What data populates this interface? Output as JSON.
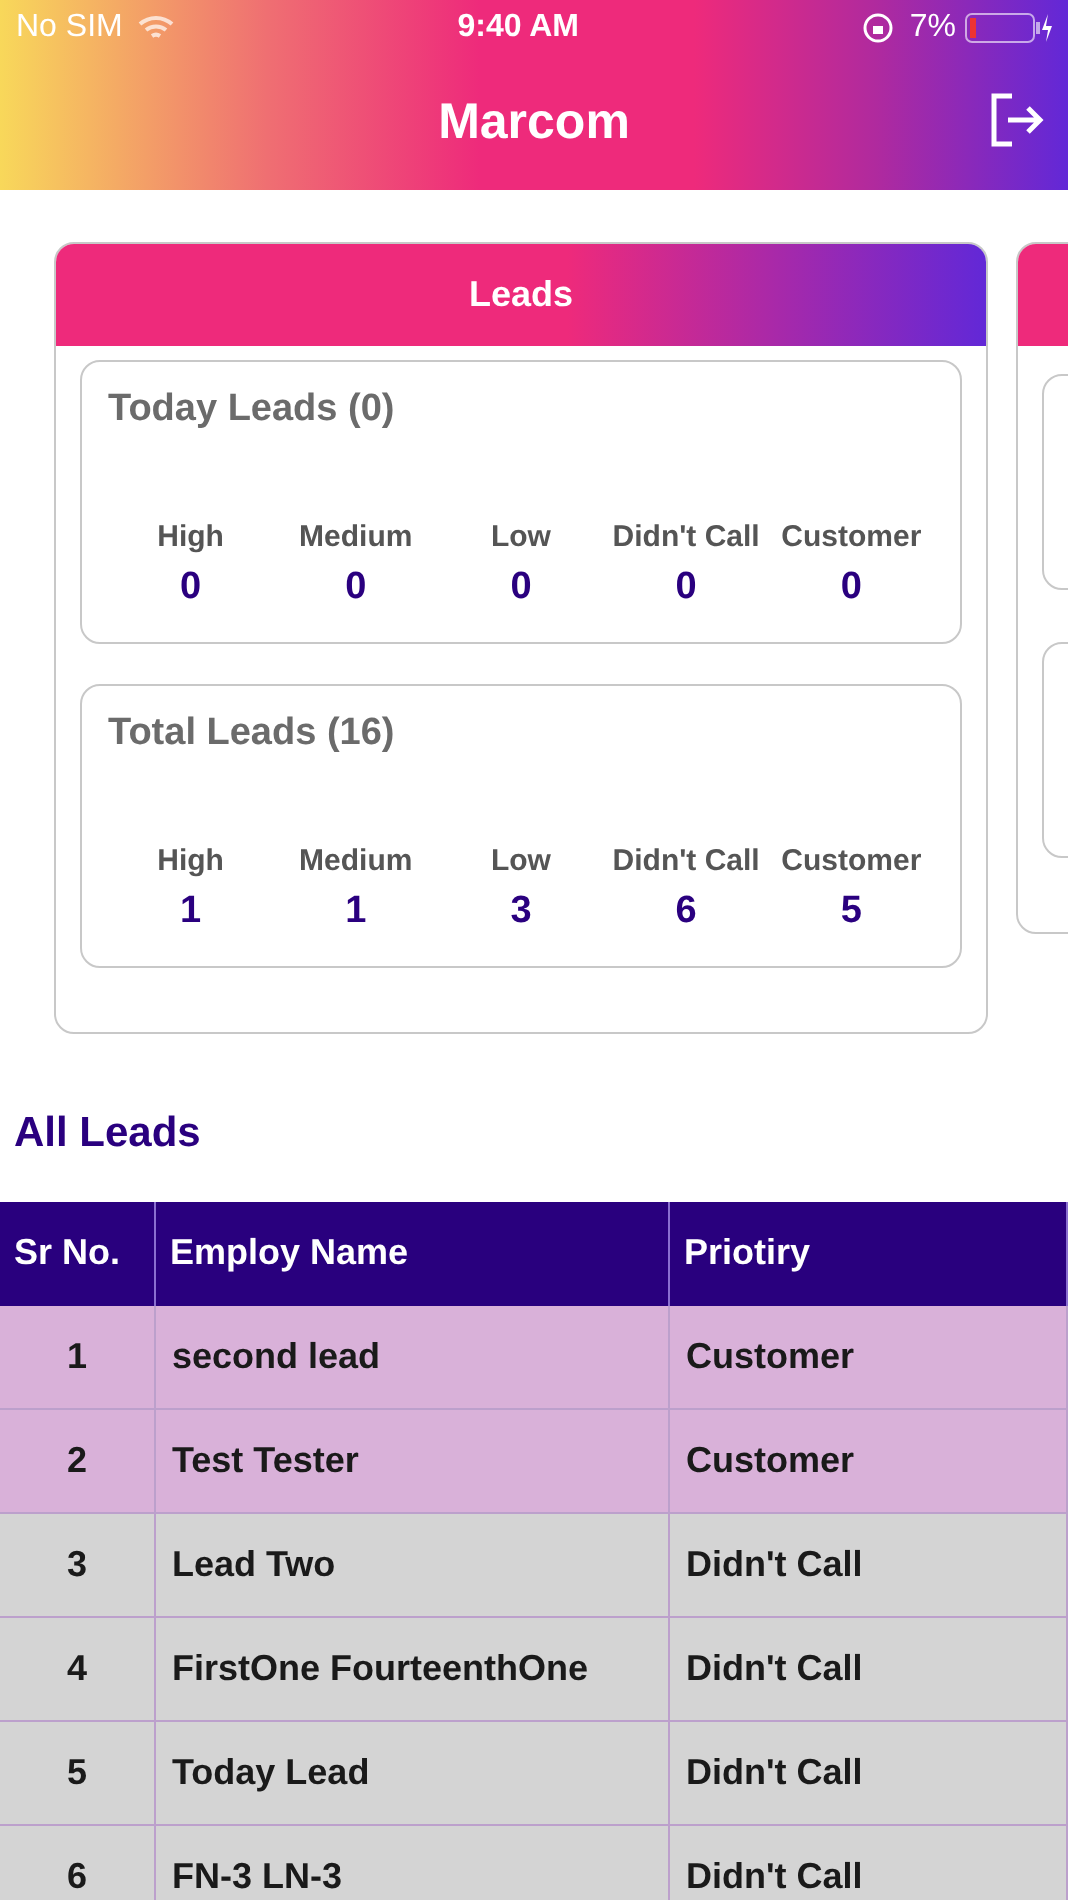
{
  "status_bar": {
    "carrier": "No SIM",
    "time": "9:40 AM",
    "battery": "7%"
  },
  "header": {
    "title": "Marcom"
  },
  "card": {
    "title": "Leads",
    "sections": [
      {
        "title": "Today Leads (0)",
        "stats": [
          {
            "label": "High",
            "value": "0"
          },
          {
            "label": "Medium",
            "value": "0"
          },
          {
            "label": "Low",
            "value": "0"
          },
          {
            "label": "Didn't Call",
            "value": "0"
          },
          {
            "label": "Customer",
            "value": "0"
          }
        ]
      },
      {
        "title": "Total Leads (16)",
        "stats": [
          {
            "label": "High",
            "value": "1"
          },
          {
            "label": "Medium",
            "value": "1"
          },
          {
            "label": "Low",
            "value": "3"
          },
          {
            "label": "Didn't Call",
            "value": "6"
          },
          {
            "label": "Customer",
            "value": "5"
          }
        ]
      }
    ]
  },
  "all_leads": {
    "title": "All Leads",
    "table": {
      "columns": [
        "Sr No.",
        "Employ Name",
        "Priotiry"
      ],
      "rows": [
        {
          "cells": [
            "1",
            "second lead",
            "Customer"
          ],
          "color": "#d9b1d9"
        },
        {
          "cells": [
            "2",
            "Test Tester",
            "Customer"
          ],
          "color": "#d9b1d9"
        },
        {
          "cells": [
            "3",
            "Lead Two",
            "Didn't Call"
          ],
          "color": "#d4d4d4"
        },
        {
          "cells": [
            "4",
            "FirstOne FourteenthOne",
            "Didn't Call"
          ],
          "color": "#d4d4d4"
        },
        {
          "cells": [
            "5",
            "Today Lead",
            "Didn't Call"
          ],
          "color": "#d4d4d4"
        },
        {
          "cells": [
            "6",
            "FN-3 LN-3",
            "Didn't Call"
          ],
          "color": "#d4d4d4"
        }
      ]
    }
  }
}
